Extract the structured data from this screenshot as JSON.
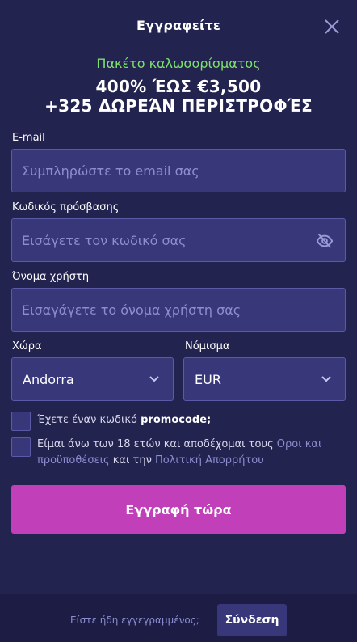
{
  "header": {
    "title": "Εγγραφείτε",
    "close_icon": "close-icon"
  },
  "promo": {
    "subtitle": "Πακέτο καλωσορίσματος",
    "line1": "400% ΈΩΣ €3,500",
    "line2": "+325 ΔΩΡΕΆΝ ΠΕΡΙΣΤΡΟΦΈΣ",
    "subtitle_color": "#7ee06d"
  },
  "form": {
    "email": {
      "label": "E-mail",
      "placeholder": "Συμπληρώστε το email σας",
      "value": ""
    },
    "password": {
      "label": "Κωδικός πρόσβασης",
      "placeholder": "Εισάγετε τον κωδικό σας",
      "value": "",
      "toggle_icon": "eye-off-icon"
    },
    "username": {
      "label": "Όνομα χρήστη",
      "placeholder": "Εισαγάγετε το όνομα χρήστη σας",
      "value": ""
    },
    "country": {
      "label": "Χώρα",
      "value": "Andorra"
    },
    "currency": {
      "label": "Νόμισμα",
      "value": "EUR"
    },
    "promocode": {
      "text_prefix": "Έχετε έναν κωδικό ",
      "text_bold": "promocode;"
    },
    "terms": {
      "text_prefix": "Είμαι άνω των 18 ετών και αποδέχομαι τους ",
      "terms_link": "Οροι και προϋποθέσεις",
      "text_middle": " και την ",
      "privacy_link": "Πολιτική Απορρήτου"
    },
    "submit_label": "Εγγραφή τώρα"
  },
  "footer": {
    "text": "Είστε ήδη εγγεγραμμένος;",
    "login_label": "Σύνδεση"
  },
  "colors": {
    "background": "#23234f",
    "input_bg": "#37377a",
    "input_border": "#5a5aa6",
    "accent": "#c23fba",
    "footer_bg": "#1c1c44"
  }
}
